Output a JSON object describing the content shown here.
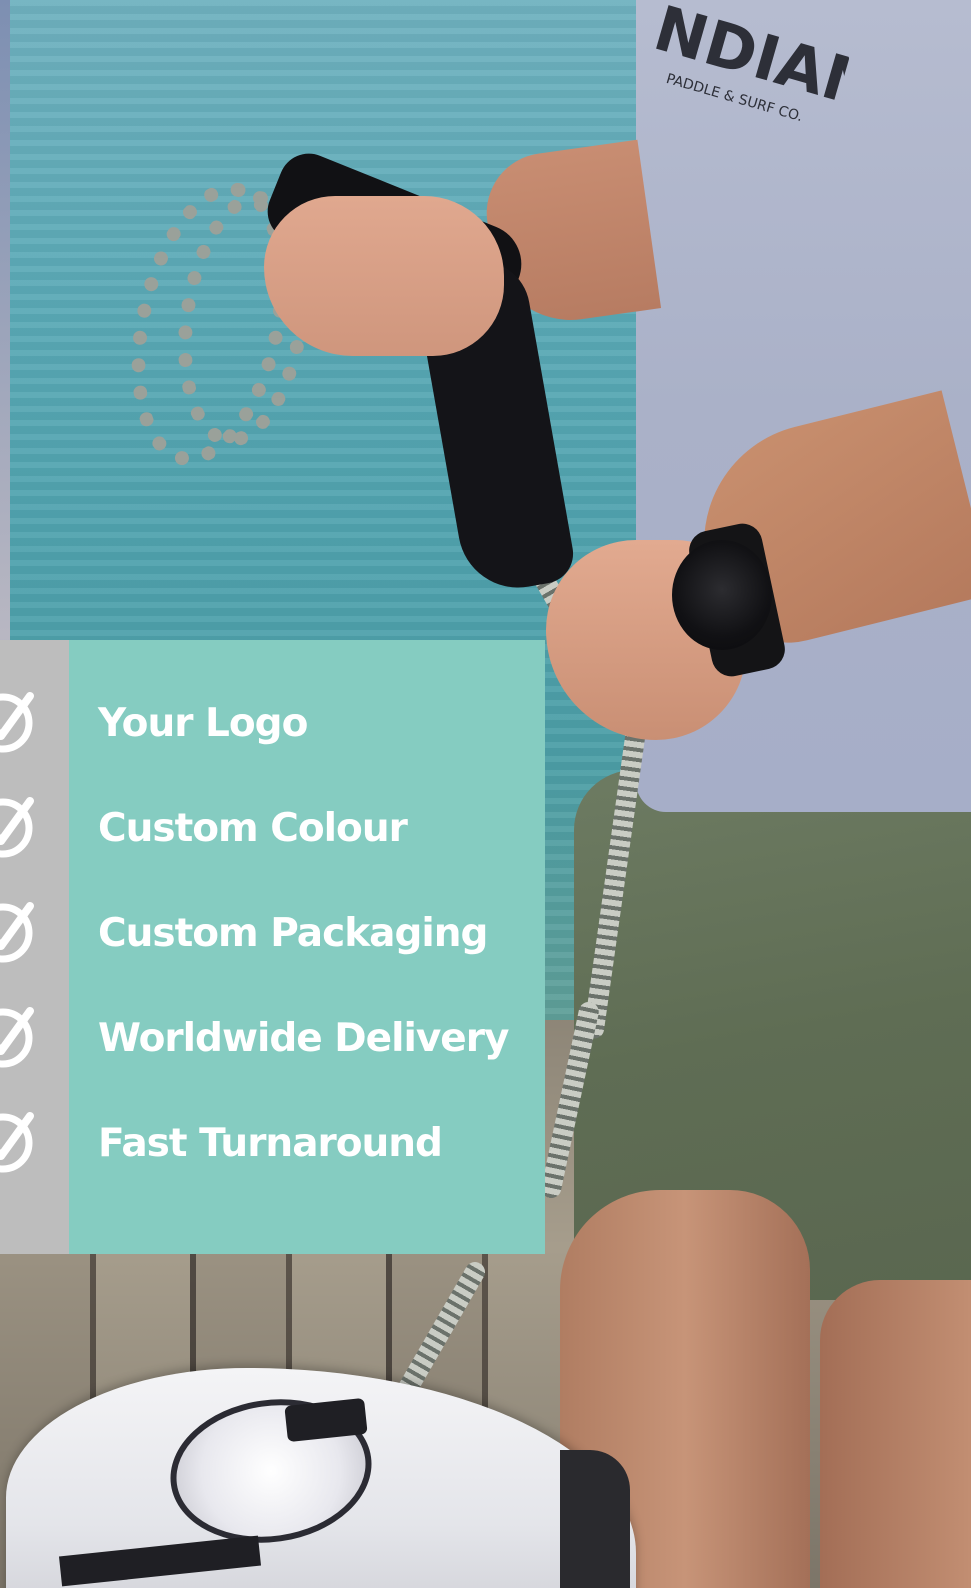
{
  "features": [
    {
      "label": "Your Logo",
      "icon": "check-circle-icon"
    },
    {
      "label": "Custom Colour",
      "icon": "check-circle-icon"
    },
    {
      "label": "Custom Packaging",
      "icon": "check-circle-icon"
    },
    {
      "label": "Worldwide Delivery",
      "icon": "check-circle-icon"
    },
    {
      "label": "Fast Turnaround",
      "icon": "check-circle-icon"
    }
  ],
  "shirt_print": {
    "brand": "NDIANA",
    "tagline": "PADDLE & SURF CO."
  },
  "colors": {
    "panel_teal": "#85ccc1",
    "panel_gray": "#bdbdbd",
    "text": "#ffffff"
  }
}
